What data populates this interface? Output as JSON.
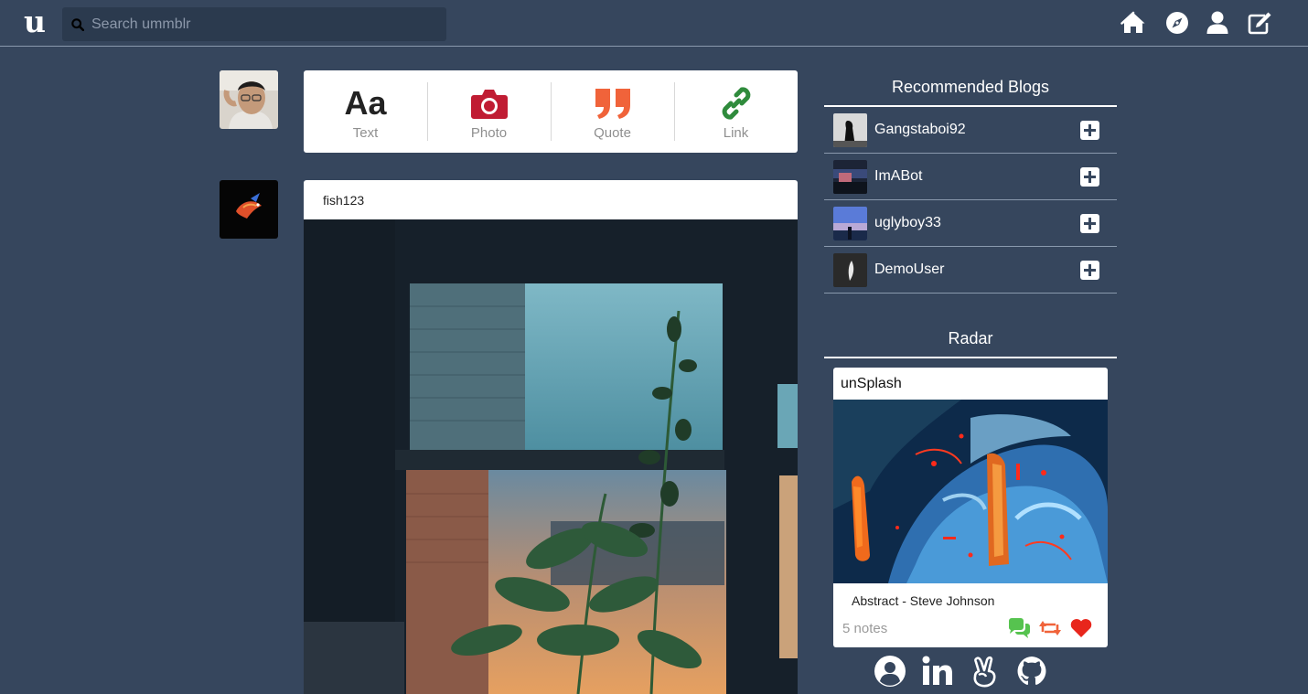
{
  "header": {
    "logo_text": "u",
    "search": {
      "placeholder": "Search ummblr",
      "value": ""
    },
    "nav_icons": [
      "home-icon",
      "compass-icon",
      "user-icon",
      "edit-icon"
    ]
  },
  "composer": {
    "text_glyph": "Aa",
    "items": [
      {
        "label": "Text",
        "icon": "text-icon",
        "color": "#222222"
      },
      {
        "label": "Photo",
        "icon": "camera-icon",
        "color": "#c01c33"
      },
      {
        "label": "Quote",
        "icon": "quote-icon",
        "color": "#f0633a"
      },
      {
        "label": "Link",
        "icon": "link-icon",
        "color": "#2f8b3c"
      }
    ]
  },
  "post": {
    "username": "fish123"
  },
  "sidebar": {
    "recommended_title": "Recommended Blogs",
    "blogs": [
      {
        "name": "Gangstaboi92"
      },
      {
        "name": "ImABot"
      },
      {
        "name": "uglyboy33"
      },
      {
        "name": "DemoUser"
      }
    ],
    "radar_title": "Radar",
    "radar": {
      "blog": "unSplash",
      "caption": "Abstract - Steve Johnson",
      "notes": "5 notes",
      "reply_color": "#56c34f",
      "reblog_color": "#f0633a",
      "like_color": "#e8261c"
    }
  },
  "footer_icons": [
    "profile-icon",
    "linkedin-icon",
    "angellist-icon",
    "github-icon"
  ]
}
